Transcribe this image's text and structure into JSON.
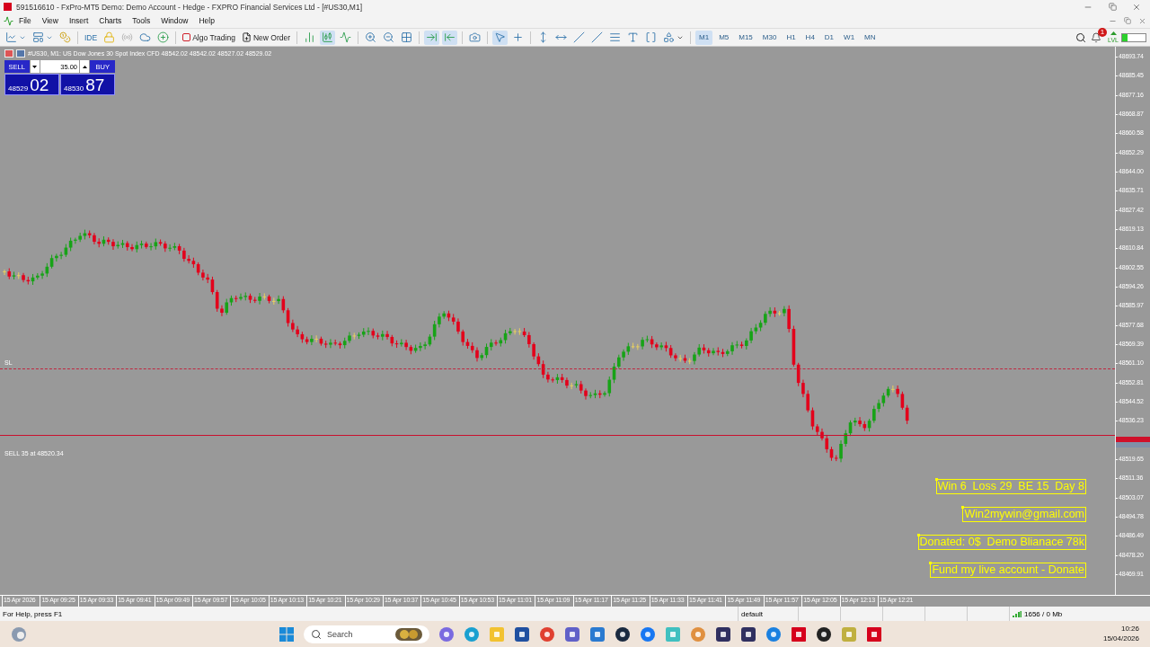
{
  "window": {
    "title": "591516610 - FxPro-MT5 Demo: Demo Account - Hedge - FXPRO Financial Services Ltd - [#US30,M1]"
  },
  "menu": [
    "File",
    "View",
    "Insert",
    "Charts",
    "Tools",
    "Window",
    "Help"
  ],
  "toolbar": {
    "ide": "IDE",
    "algo_trading": "Algo Trading",
    "new_order": "New Order",
    "timeframes": [
      {
        "label": "M1",
        "selected": true
      },
      {
        "label": "M5",
        "selected": false
      },
      {
        "label": "M15",
        "selected": false
      },
      {
        "label": "M30",
        "selected": false
      },
      {
        "label": "H1",
        "selected": false
      },
      {
        "label": "H4",
        "selected": false
      },
      {
        "label": "D1",
        "selected": false
      },
      {
        "label": "W1",
        "selected": false
      },
      {
        "label": "MN",
        "selected": false
      }
    ],
    "notification_count": "1",
    "signal_label": "LVL"
  },
  "chart": {
    "header": "#US30, M1:  US Dow Jones 30 Spot Index CFD  48542.02 48542.02 48527.02 48529.02",
    "trade_panel": {
      "sell": "SELL",
      "buy": "BUY",
      "volume": "35.00",
      "bid_main": "48529",
      "bid_pips": "02",
      "ask_main": "48530",
      "ask_pips": "87"
    },
    "price_axis_above": [
      "48693.74",
      "48685.45",
      "48677.16",
      "48668.87",
      "48660.58",
      "48652.29",
      "48644.00",
      "48635.71",
      "48627.42",
      "48619.13",
      "48610.84",
      "48602.55",
      "48594.26",
      "48585.97",
      "48577.68",
      "48569.39",
      "48561.10",
      "48552.81",
      "48544.52",
      "48536.23"
    ],
    "price_axis_below": [
      "48519.65",
      "48511.36",
      "48503.07",
      "48494.78",
      "48486.49",
      "48478.20",
      "48469.91"
    ],
    "time_axis": [
      "15 Apr 2026",
      "15 Apr 09:25",
      "15 Apr 09:33",
      "15 Apr 09:41",
      "15 Apr 09:49",
      "15 Apr 09:57",
      "15 Apr 10:05",
      "15 Apr 10:13",
      "15 Apr 10:21",
      "15 Apr 10:29",
      "15 Apr 10:37",
      "15 Apr 10:45",
      "15 Apr 10:53",
      "15 Apr 11:01",
      "15 Apr 11:09",
      "15 Apr 11:17",
      "15 Apr 11:25",
      "15 Apr 11:33",
      "15 Apr 11:41",
      "15 Apr 11:49",
      "15 Apr 11:57",
      "15 Apr 12:05",
      "15 Apr 12:13",
      "15 Apr 12:21"
    ],
    "lines": [
      {
        "kind": "stop_loss",
        "label": "SL"
      },
      {
        "kind": "position",
        "label": "SELL 35 at 48520.34"
      }
    ],
    "notes": [
      "Win 6  Loss 29  BE 15  Day 8",
      "Win2mywin@gmail.com",
      "Donated: 0$  Demo Blianace 78k",
      "Fund my live account - Donate"
    ]
  },
  "status_bar": {
    "help": "For Help, press F1",
    "profile": "default",
    "traffic": "1656 / 0 Mb"
  },
  "taskbar": {
    "search_placeholder": "Search",
    "time": "10:26",
    "date": "15/04/2026"
  }
}
